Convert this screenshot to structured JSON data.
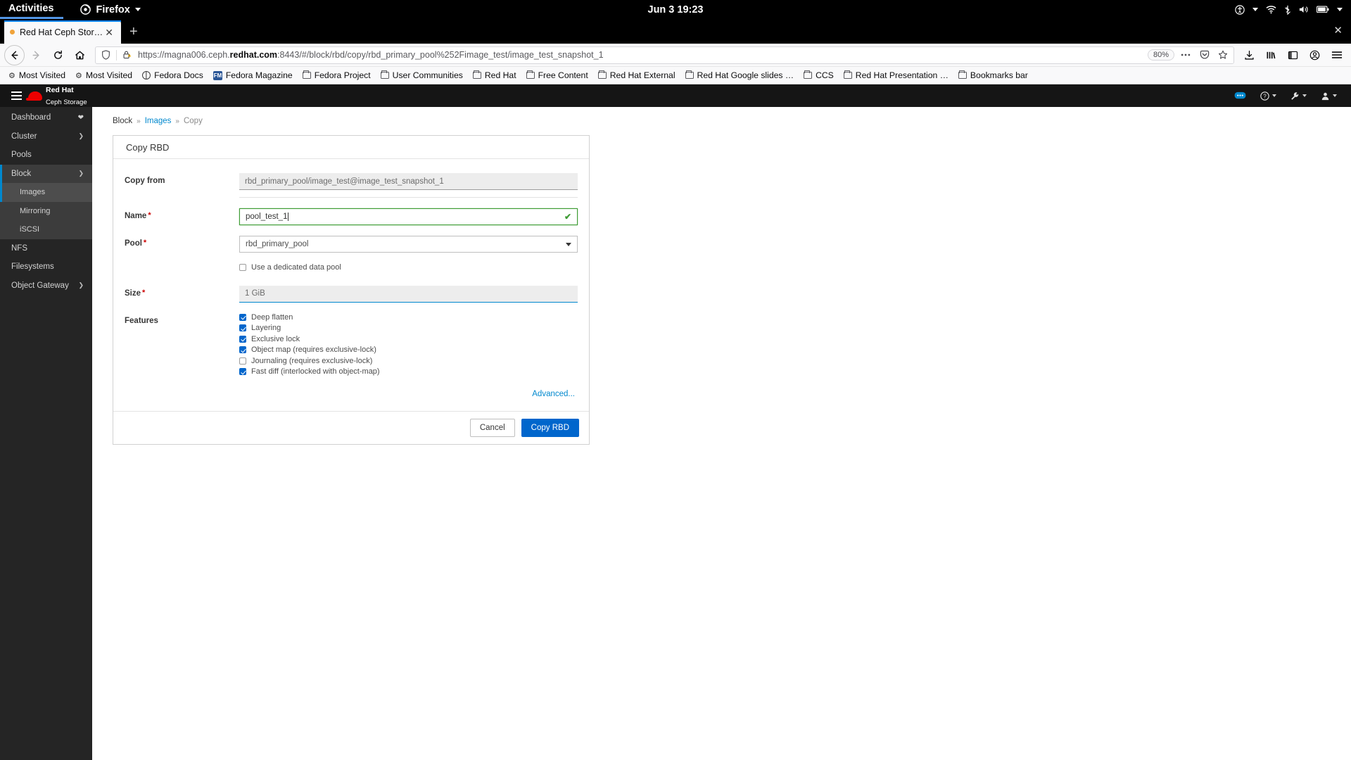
{
  "gnome": {
    "activities": "Activities",
    "app_name": "Firefox",
    "clock": "Jun 3  19:23",
    "icons": [
      "accessibility-icon",
      "wifi-icon",
      "bluetooth-icon",
      "volume-icon",
      "battery-icon",
      "chevron-down-icon"
    ]
  },
  "browser": {
    "tab": {
      "title": "Red Hat Ceph Storage",
      "close_label": "✕",
      "loading_dot": "loading-indicator"
    },
    "new_tab_label": "+",
    "window_close_label": "✕",
    "nav": {
      "back": "←",
      "forward": "→",
      "reload": "⟳",
      "home": "⌂"
    },
    "url": {
      "prefix": "https://magna006.ceph.",
      "domain": "redhat.com",
      "suffix": ":8443/#/block/rbd/copy/rbd_primary_pool%252Fimage_test/image_test_snapshot_1",
      "zoom_level": "80%"
    },
    "bookmarks": [
      {
        "label": "Most Visited",
        "icon": "gear-icon"
      },
      {
        "label": "Most Visited",
        "icon": "gear-icon"
      },
      {
        "label": "Fedora Docs",
        "icon": "globe-icon"
      },
      {
        "label": "Fedora Magazine",
        "icon": "fm-icon"
      },
      {
        "label": "Fedora Project",
        "icon": "folder-icon"
      },
      {
        "label": "User Communities",
        "icon": "folder-icon"
      },
      {
        "label": "Red Hat",
        "icon": "folder-icon"
      },
      {
        "label": "Free Content",
        "icon": "folder-icon"
      },
      {
        "label": "Red Hat External",
        "icon": "folder-icon"
      },
      {
        "label": "Red Hat Google slides …",
        "icon": "folder-icon"
      },
      {
        "label": "CCS",
        "icon": "folder-icon"
      },
      {
        "label": "Red Hat Presentation …",
        "icon": "folder-icon"
      },
      {
        "label": "Bookmarks bar",
        "icon": "folder-icon"
      }
    ]
  },
  "ceph": {
    "brand": {
      "line1": "Red Hat",
      "line2": "Ceph Storage"
    },
    "topbar_icons": [
      "tasks-icon",
      "help-icon",
      "tools-icon",
      "user-icon"
    ],
    "sidebar": [
      {
        "label": "Dashboard",
        "badge": "❤",
        "has_chevron": false,
        "state": "normal"
      },
      {
        "label": "Cluster",
        "has_chevron": true,
        "state": "normal"
      },
      {
        "label": "Pools",
        "has_chevron": false,
        "state": "normal"
      },
      {
        "label": "Block",
        "has_chevron": true,
        "state": "active"
      },
      {
        "label": "NFS",
        "has_chevron": false,
        "state": "normal"
      },
      {
        "label": "Filesystems",
        "has_chevron": false,
        "state": "normal"
      },
      {
        "label": "Object Gateway",
        "has_chevron": true,
        "state": "normal"
      }
    ],
    "block_children": [
      {
        "label": "Images",
        "state": "selected"
      },
      {
        "label": "Mirroring",
        "state": "normal"
      },
      {
        "label": "iSCSI",
        "state": "normal"
      }
    ],
    "breadcrumb": {
      "root": "Block",
      "link": "Images",
      "current": "Copy",
      "separator": "»"
    },
    "form": {
      "title": "Copy RBD",
      "copy_from": {
        "label": "Copy from",
        "value": "rbd_primary_pool/image_test@image_test_snapshot_1"
      },
      "name": {
        "label": "Name",
        "value": "pool_test_1",
        "required": "*",
        "valid_mark": "✔"
      },
      "pool": {
        "label": "Pool",
        "value": "rbd_primary_pool",
        "required": "*"
      },
      "dedicated_pool": {
        "label": "Use a dedicated data pool",
        "checked": false
      },
      "size": {
        "label": "Size",
        "value": "1 GiB",
        "required": "*"
      },
      "features": {
        "label": "Features",
        "items": [
          {
            "label": "Deep flatten",
            "checked": true
          },
          {
            "label": "Layering",
            "checked": true
          },
          {
            "label": "Exclusive lock",
            "checked": true
          },
          {
            "label": "Object map (requires exclusive-lock)",
            "checked": true
          },
          {
            "label": "Journaling (requires exclusive-lock)",
            "checked": false
          },
          {
            "label": "Fast diff (interlocked with object-map)",
            "checked": true
          }
        ]
      },
      "advanced_link": "Advanced...",
      "cancel_button": "Cancel",
      "submit_button": "Copy RBD"
    }
  },
  "colors": {
    "accent_blue": "#0088ce",
    "primary_button": "#0066cc",
    "redhat_red": "#ee0000",
    "focus_green": "#3f9c35",
    "required_red": "#cc0000"
  }
}
